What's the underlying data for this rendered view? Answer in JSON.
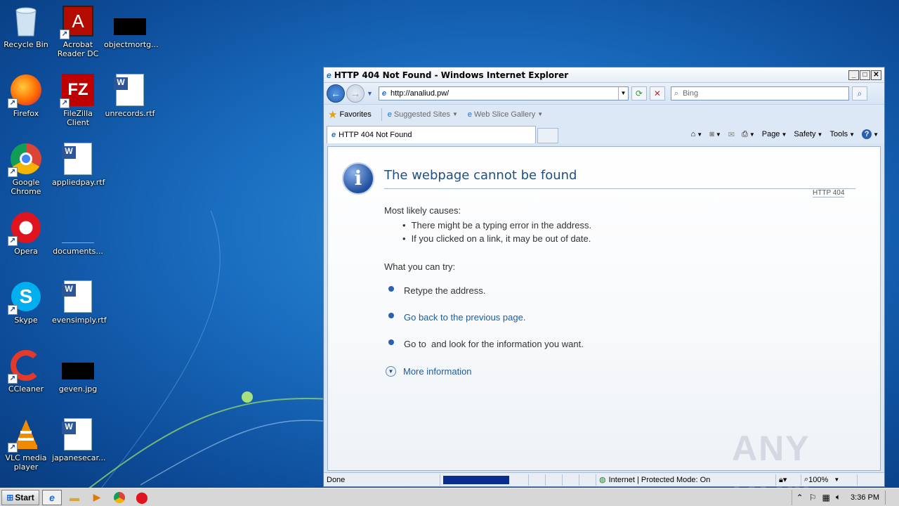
{
  "desktop": {
    "icons": [
      {
        "label": "Recycle Bin"
      },
      {
        "label": "Acrobat Reader DC"
      },
      {
        "label": "objectmortg..."
      },
      {
        "label": "Firefox"
      },
      {
        "label": "FileZilla Client"
      },
      {
        "label": "unrecords.rtf"
      },
      {
        "label": "Google Chrome"
      },
      {
        "label": "appliedpay.rtf"
      },
      {
        "label": "Opera"
      },
      {
        "label": "documents..."
      },
      {
        "label": "Skype"
      },
      {
        "label": "evensimply.rtf"
      },
      {
        "label": "CCleaner"
      },
      {
        "label": "geven.jpg"
      },
      {
        "label": "VLC media player"
      },
      {
        "label": "japanesecar..."
      }
    ]
  },
  "ie": {
    "title": "HTTP 404 Not Found - Windows Internet Explorer",
    "address": "http://analiud.pw/",
    "search_placeholder": "Bing",
    "favorites_label": "Favorites",
    "suggested_sites": "Suggested Sites",
    "web_slice": "Web Slice Gallery",
    "tab_label": "HTTP 404 Not Found",
    "cmd": {
      "page": "Page",
      "safety": "Safety",
      "tools": "Tools"
    },
    "page": {
      "title": "The webpage cannot be found",
      "code": "HTTP 404",
      "causes_heading": "Most likely causes:",
      "causes": [
        "There might be a typing error in the address.",
        "If you clicked on a link, it may be out of date."
      ],
      "try_heading": "What you can try:",
      "try": [
        "Retype the address.",
        "Go back to the previous page.",
        "Go to  and look for the information you want."
      ],
      "more_info": "More information",
      "watermark": "ANY RUN"
    },
    "status": {
      "text": "Done",
      "zone": "Internet | Protected Mode: On",
      "zoom": "100%"
    }
  },
  "taskbar": {
    "start": "Start",
    "clock": "3:36 PM"
  }
}
